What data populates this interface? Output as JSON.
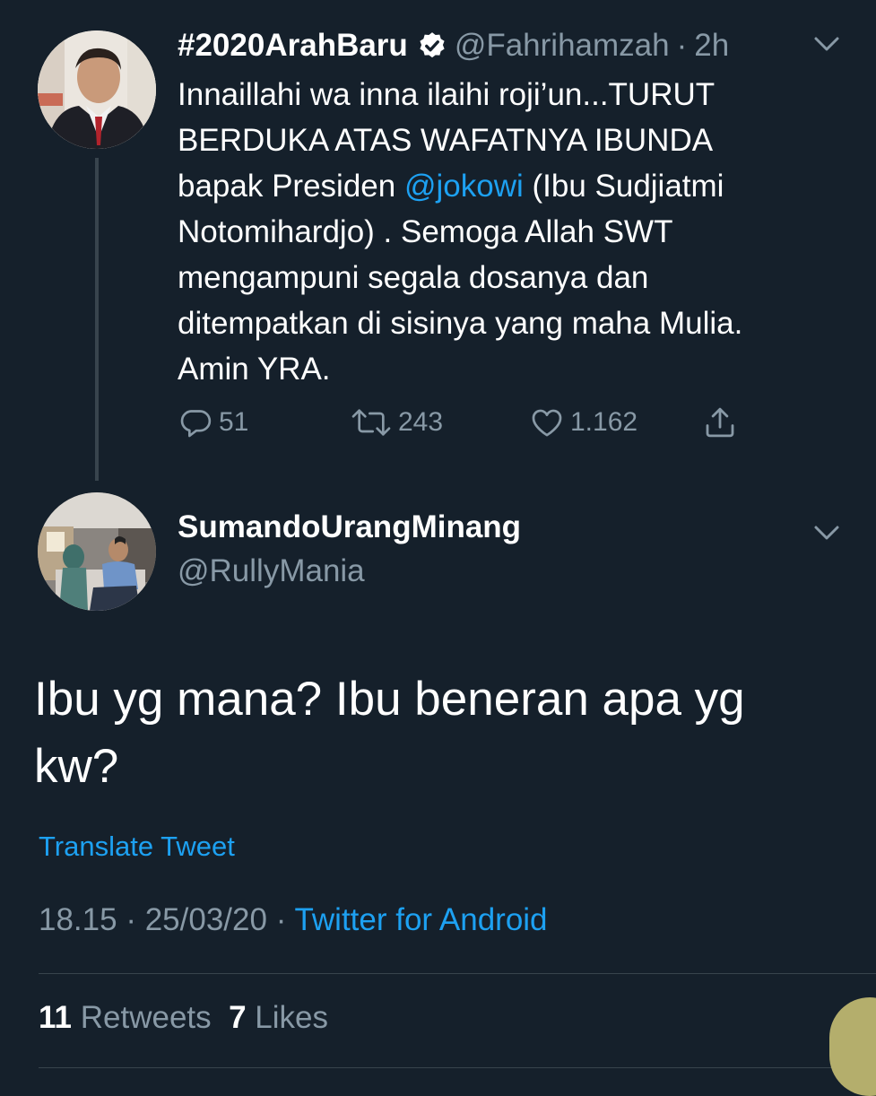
{
  "parent_tweet": {
    "display_name": "#2020ArahBaru",
    "handle": "@Fahrihamzah",
    "separator": "·",
    "time": "2h",
    "text_lines": [
      "Innaillahi wa inna ilaihi roji’un...TURUT",
      "BERDUKA ATAS WAFATNYA IBUNDA",
      {
        "before": "bapak Presiden ",
        "mention": "@jokowi",
        "after": " (Ibu Sudjiatmi"
      },
      "Notomihardjo) . Semoga Allah SWT",
      "mengampuni segala dosanya dan",
      "ditempatkan di sisinya yang maha Mulia.",
      "Amin YRA."
    ],
    "actions": {
      "replies": "51",
      "retweets": "243",
      "likes": "1.162"
    },
    "icons": [
      "verified-badge-icon",
      "chevron-down-icon",
      "reply-icon",
      "retweet-icon",
      "like-icon",
      "share-icon"
    ]
  },
  "reply_tweet": {
    "display_name": "SumandoUrangMinang",
    "handle": "@RullyMania",
    "text_lines": [
      "Ibu yg mana? Ibu beneran apa yg",
      "kw?"
    ],
    "translate_label": "Translate Tweet",
    "time": "18.15",
    "separator": "·",
    "date": "25/03/20",
    "source": "Twitter for Android",
    "retweet_count": "11",
    "retweet_label": "Retweets",
    "like_count": "7",
    "like_label": "Likes"
  },
  "colors": {
    "background": "#15202b",
    "text": "#ffffff",
    "secondary": "#8899a6",
    "link": "#1da1f2",
    "divider": "#38444d"
  }
}
